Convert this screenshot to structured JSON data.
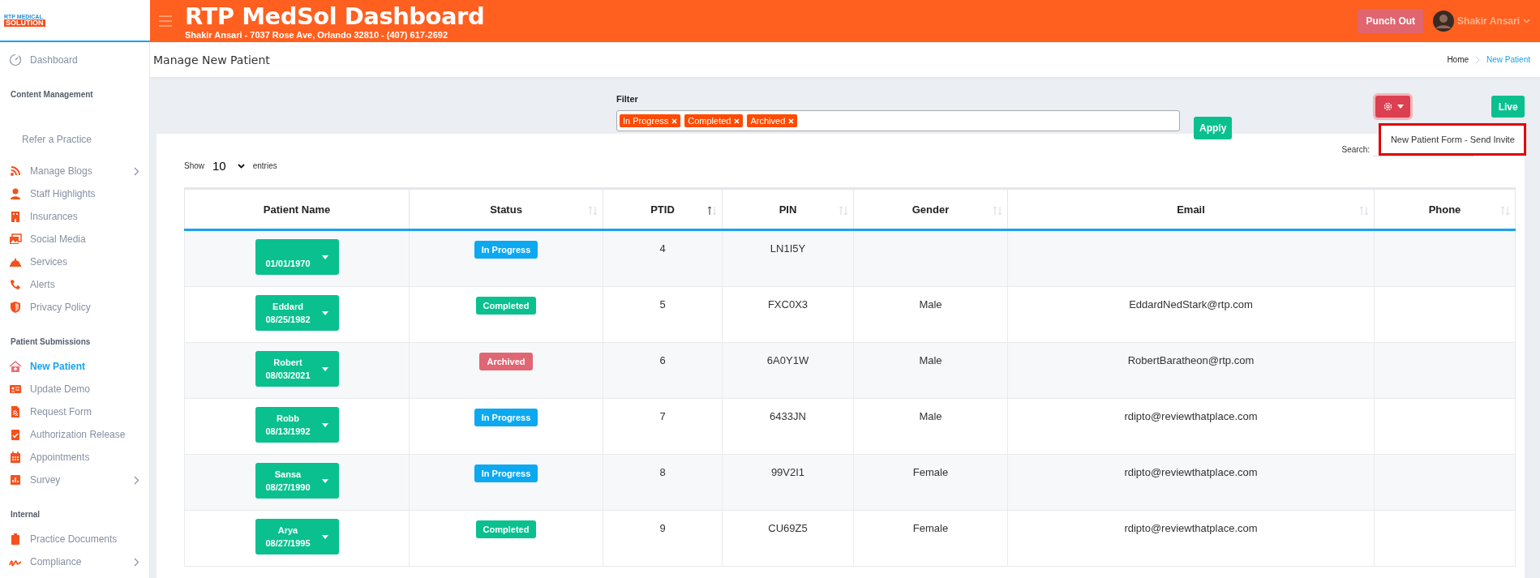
{
  "logo_text": [
    "RTP MEDICAL",
    "SOLUTION"
  ],
  "header": {
    "title": "RTP MedSol Dashboard",
    "subtitle": "Shakir Ansari - 7037 Rose Ave, Orlando 32810 - (407) 617-2692",
    "punch_button": "Punch Out",
    "user_name": "Shakir Ansari"
  },
  "sidebar": {
    "items": [
      {
        "kind": "link",
        "label": "Dashboard",
        "selected": false,
        "has_submenu": false
      },
      {
        "kind": "heading",
        "label": "Content Management"
      },
      {
        "kind": "plain",
        "label": "Refer a Practice",
        "selected": false,
        "has_submenu": false
      },
      {
        "kind": "link",
        "label": "Manage Blogs",
        "selected": false,
        "has_submenu": true
      },
      {
        "kind": "link",
        "label": "Staff Highlights",
        "selected": false,
        "has_submenu": false
      },
      {
        "kind": "link",
        "label": "Insurances",
        "selected": false,
        "has_submenu": false
      },
      {
        "kind": "link",
        "label": "Social Media",
        "selected": false,
        "has_submenu": false
      },
      {
        "kind": "link",
        "label": "Services",
        "selected": false,
        "has_submenu": false
      },
      {
        "kind": "link",
        "label": "Alerts",
        "selected": false,
        "has_submenu": false
      },
      {
        "kind": "link",
        "label": "Privacy Policy",
        "selected": false,
        "has_submenu": false
      },
      {
        "kind": "heading",
        "label": "Patient Submissions"
      },
      {
        "kind": "link",
        "label": "New Patient",
        "selected": true,
        "has_submenu": false
      },
      {
        "kind": "link",
        "label": "Update Demo",
        "selected": false,
        "has_submenu": false
      },
      {
        "kind": "link",
        "label": "Request Form",
        "selected": false,
        "has_submenu": false
      },
      {
        "kind": "link",
        "label": "Authorization Release",
        "selected": false,
        "has_submenu": false
      },
      {
        "kind": "link",
        "label": "Appointments",
        "selected": false,
        "has_submenu": false
      },
      {
        "kind": "link",
        "label": "Survey",
        "selected": false,
        "has_submenu": true
      },
      {
        "kind": "heading",
        "label": "Internal"
      },
      {
        "kind": "link",
        "label": "Practice Documents",
        "selected": false,
        "has_submenu": false
      },
      {
        "kind": "link",
        "label": "Compliance",
        "selected": false,
        "has_submenu": true
      }
    ]
  },
  "page_title": "Manage New Patient",
  "breadcrumb": [
    {
      "label": "Home",
      "selected": false
    },
    {
      "label": "New Patient",
      "selected": true
    }
  ],
  "filter": {
    "label": "Filter",
    "tags": [
      "In Progress",
      "Completed",
      "Archived"
    ],
    "apply_button": "Apply"
  },
  "settings_menu": {
    "expanded": true,
    "items": [
      "New Patient Form - Send Invite"
    ]
  },
  "live_button": "Live",
  "table": {
    "show_label": "Show",
    "page_size": "10",
    "entries_label": "entries",
    "search_label": "Search:",
    "columns": [
      {
        "label": "Patient Name",
        "sortable": false
      },
      {
        "label": "Status",
        "sortable": true,
        "sorted_ascending": false
      },
      {
        "label": "PTID",
        "sortable": true,
        "sorted_ascending": true
      },
      {
        "label": "PIN",
        "sortable": true,
        "sorted_ascending": false
      },
      {
        "label": "Gender",
        "sortable": true,
        "sorted_ascending": false
      },
      {
        "label": "Email",
        "sortable": true,
        "sorted_ascending": false
      },
      {
        "label": "Phone",
        "sortable": true,
        "sorted_ascending": false
      }
    ],
    "rows": [
      {
        "dob": "01/01/1970",
        "status": {
          "label": "In Progress",
          "kind": "in_progress"
        },
        "ptid": "4",
        "pin": "LN1I5Y"
      },
      {
        "first_name": "Eddard",
        "dob": "08/25/1982",
        "status": {
          "label": "Completed",
          "kind": "completed"
        },
        "ptid": "5",
        "pin": "FXC0X3",
        "gender": "Male",
        "email": "EddardNedStark@rtp.com"
      },
      {
        "first_name": "Robert",
        "dob": "08/03/2021",
        "status": {
          "label": "Archived",
          "kind": "archived"
        },
        "ptid": "6",
        "pin": "6A0Y1W",
        "gender": "Male",
        "email": "RobertBaratheon@rtp.com"
      },
      {
        "first_name": "Robb",
        "dob": "08/13/1992",
        "status": {
          "label": "In Progress",
          "kind": "in_progress"
        },
        "ptid": "7",
        "pin": "6433JN",
        "gender": "Male",
        "email": "rdipto@reviewthatplace.com"
      },
      {
        "first_name": "Sansa",
        "dob": "08/27/1990",
        "status": {
          "label": "In Progress",
          "kind": "in_progress"
        },
        "ptid": "8",
        "pin": "99V2I1",
        "gender": "Female",
        "email": "rdipto@reviewthatplace.com"
      },
      {
        "first_name": "Arya",
        "dob": "08/27/1995",
        "status": {
          "label": "Completed",
          "kind": "completed"
        },
        "ptid": "9",
        "pin": "CU69Z5",
        "gender": "Female",
        "email": "rdipto@reviewthatplace.com"
      }
    ]
  }
}
